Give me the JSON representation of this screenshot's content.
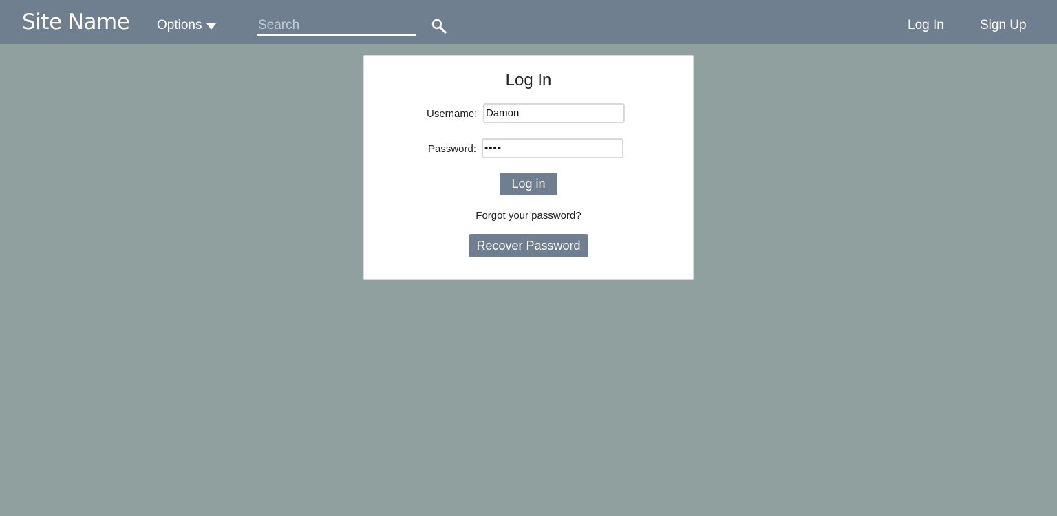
{
  "navbar": {
    "site_name": "Site Name",
    "options_label": "Options",
    "search_placeholder": "Search",
    "search_icon": "magnifier-icon",
    "login_link": "Log In",
    "signup_link": "Sign Up",
    "background_color": "#6f7f8f"
  },
  "page": {
    "background_color": "#8fa09f"
  },
  "login_form": {
    "title": "Log In",
    "username_label": "Username:",
    "username_value": "Damon",
    "password_label": "Password:",
    "password_value": "••••",
    "login_button": "Log in",
    "forgot_text": "Forgot your password?",
    "recover_button": "Recover Password"
  }
}
